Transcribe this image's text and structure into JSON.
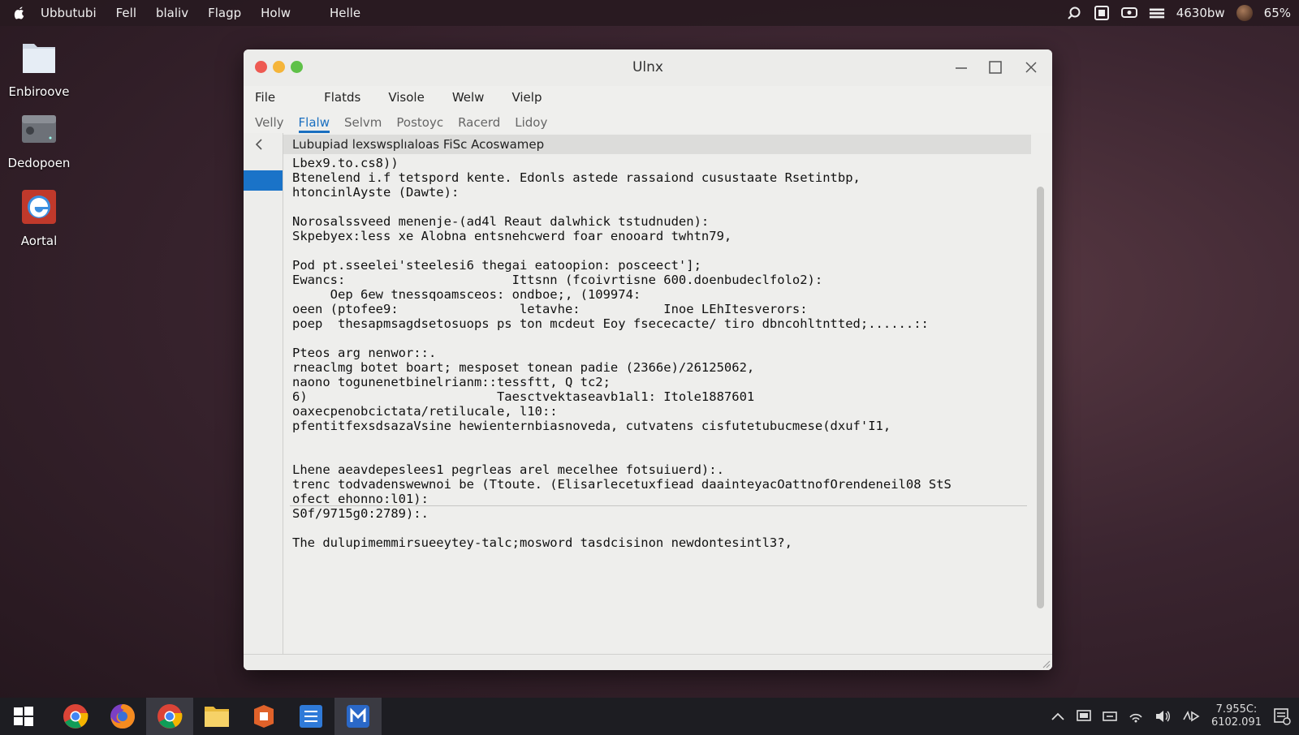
{
  "topbar": {
    "menus": [
      "Ubbutubi",
      "Fell",
      "blaliv",
      "Flagp",
      "Holw",
      "Helle"
    ],
    "network_label": "4630bw",
    "battery": "65%"
  },
  "desktop": {
    "icons": [
      {
        "label": "Enbiroove",
        "icon": "folder-icon"
      },
      {
        "label": "Dedopoen",
        "icon": "drive-icon"
      },
      {
        "label": "Aortal",
        "icon": "browser-icon"
      }
    ]
  },
  "window": {
    "title": "Ulnx",
    "menus": [
      "File",
      "Flatds",
      "Visole",
      "Welw",
      "Vielp"
    ],
    "tabs": [
      "Velly",
      "Flalw",
      "Selvm",
      "Postoyc",
      "Racerd",
      "Lidoy"
    ],
    "active_tab": "Flalw",
    "header": "Lubupiad lexswsplıaloas FiSc  Acoswamep",
    "lines": [
      "Lbex9.to.cs8))",
      "Btenelend i.f tetspord kente. Edonls astede rassaiond cusustaate Rsetintbp,",
      "htoncinlAyste (Dawte):",
      "",
      "Norosalssveed menenje-(ad4l Reaut dalwhick tstudnuden):",
      "Skpebyex:less xe Alobna entsnehcwerd foar enooard twhtn79,",
      "",
      "Pod pt.sseelei'steelesi6 thegai eatoopion: posceect'];",
      "Ewancs:                      Ittsnn (fcoivrtisne 600.doenbudeclfolo2):",
      "     Oep 6ew tnessqoamsceos: ondboe;, (109974:",
      "oeen (ptofee9:                letavhe:           Inoe LEhItesverors:",
      "poep  thesapmsagdsetosuops ps ton mcdeut Eoy fsececacte/ tiro dbncohltntted;......::",
      "",
      "Pteos arg nenwor::.",
      "rneaclmg botet boart; mesposet tonean padie (2366e)/26125062,",
      "naono togunenetbinelrianm::tessftt, Q tc2;",
      "6)                         Taesctvektaseavb1al1: Itole1887601",
      "oaxecpenobcictata/retilucale, l10::",
      "pfentitfexsdsazaVsine hewienternbiasnoveda, cutvatens cisfutetubucmese(dxuf'I1,",
      "",
      "",
      "Lhene aeavdepeslees1 pegrleas arel mecelhee fotsuiuerd):.",
      "trenc todvadenswewnoi be (Ttoute. (Elisarlecetuxfiead daainteyacOattnofOrendeneil08 StS",
      "ofect ehonno:l01):",
      "S0f/9715g0:2789):.",
      "",
      "The dulupimemmirsueeytey-talc;mosword tasdcisinon newdontesintl3?,"
    ]
  },
  "taskbar": {
    "apps": [
      "chrome-icon",
      "firefox-icon",
      "chrome-icon",
      "files-icon",
      "office-icon",
      "notes-icon",
      "mail-icon"
    ],
    "clock_time": "7.955C:",
    "clock_date": "6102.091"
  },
  "colors": {
    "accent": "#1a73c8",
    "desktop_bg": "#3b2530"
  }
}
